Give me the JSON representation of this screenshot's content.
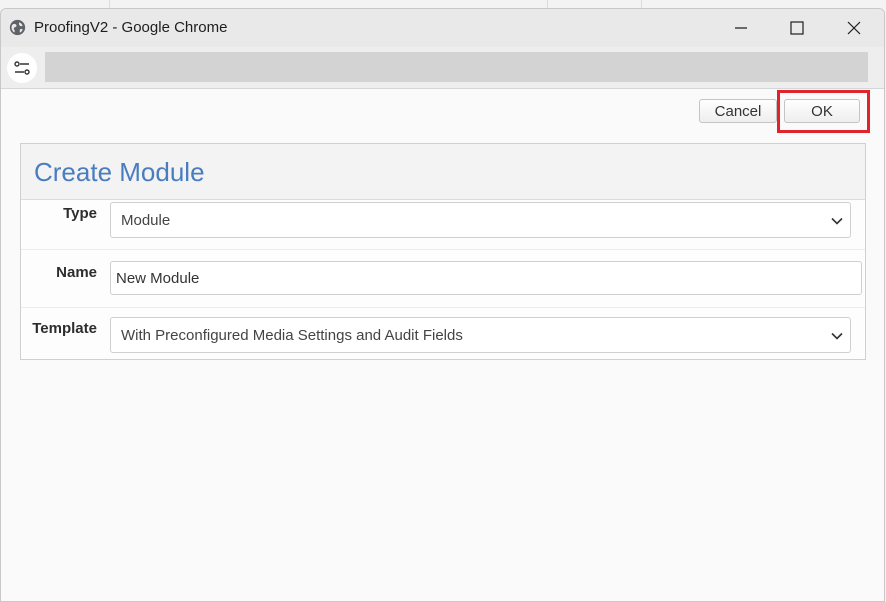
{
  "window": {
    "title": "ProofingV2 - Google Chrome"
  },
  "actions": {
    "cancel_label": "Cancel",
    "ok_label": "OK"
  },
  "form": {
    "heading": "Create Module",
    "type": {
      "label": "Type",
      "value": "Module"
    },
    "name": {
      "label": "Name",
      "value": "New Module"
    },
    "template": {
      "label": "Template",
      "value": "With Preconfigured Media Settings and Audit Fields"
    }
  },
  "colors": {
    "heading": "#4a7dc0",
    "highlight": "#e0242b"
  },
  "icons": [
    "globe-icon",
    "minimize-icon",
    "maximize-icon",
    "close-icon",
    "tune-icon",
    "chevron-down-icon"
  ]
}
